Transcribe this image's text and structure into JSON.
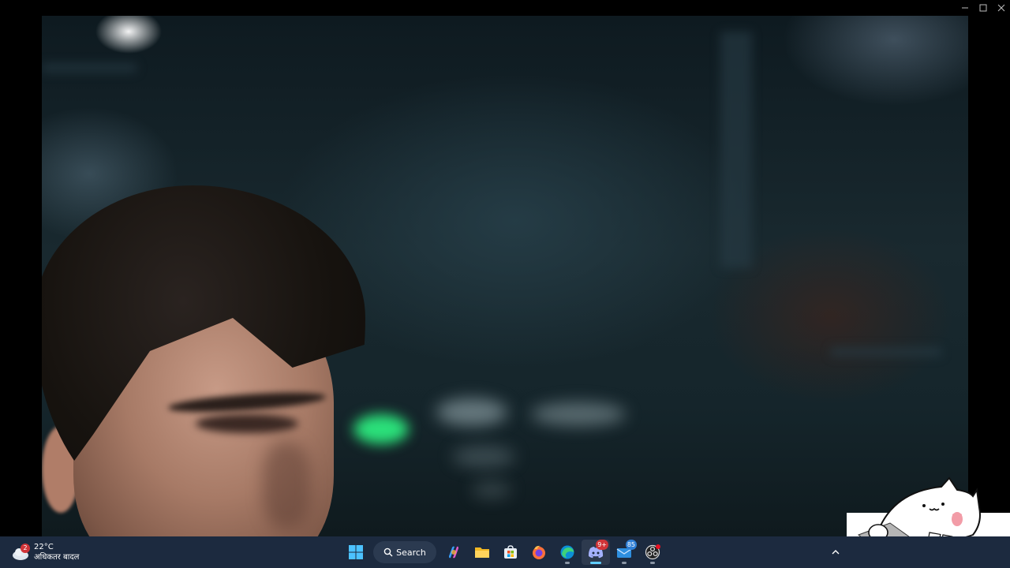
{
  "window": {
    "controls": [
      "minimize",
      "maximize",
      "close"
    ]
  },
  "video": {
    "description_icon": "video-frame"
  },
  "taskbar": {
    "weather": {
      "badge_count": "2",
      "temperature": "22°C",
      "condition": "अधिकतर बादल"
    },
    "search_label": "Search",
    "apps": [
      {
        "name": "start",
        "icon": "windows-logo-icon"
      },
      {
        "name": "copilot",
        "icon": "copilot-icon"
      },
      {
        "name": "file-explorer",
        "icon": "folder-icon"
      },
      {
        "name": "microsoft-store",
        "icon": "store-icon"
      },
      {
        "name": "firefox",
        "icon": "firefox-icon"
      },
      {
        "name": "edge",
        "icon": "edge-icon"
      },
      {
        "name": "discord",
        "icon": "discord-icon",
        "badge": "9+"
      },
      {
        "name": "mail",
        "icon": "mail-icon",
        "badge": "85"
      },
      {
        "name": "obs",
        "icon": "obs-icon"
      }
    ],
    "tray_chevron": "chevron-up-icon"
  },
  "colors": {
    "taskbar_bg": "#1c2a3f",
    "accent": "#60cdff",
    "badge_red": "#d13438"
  }
}
